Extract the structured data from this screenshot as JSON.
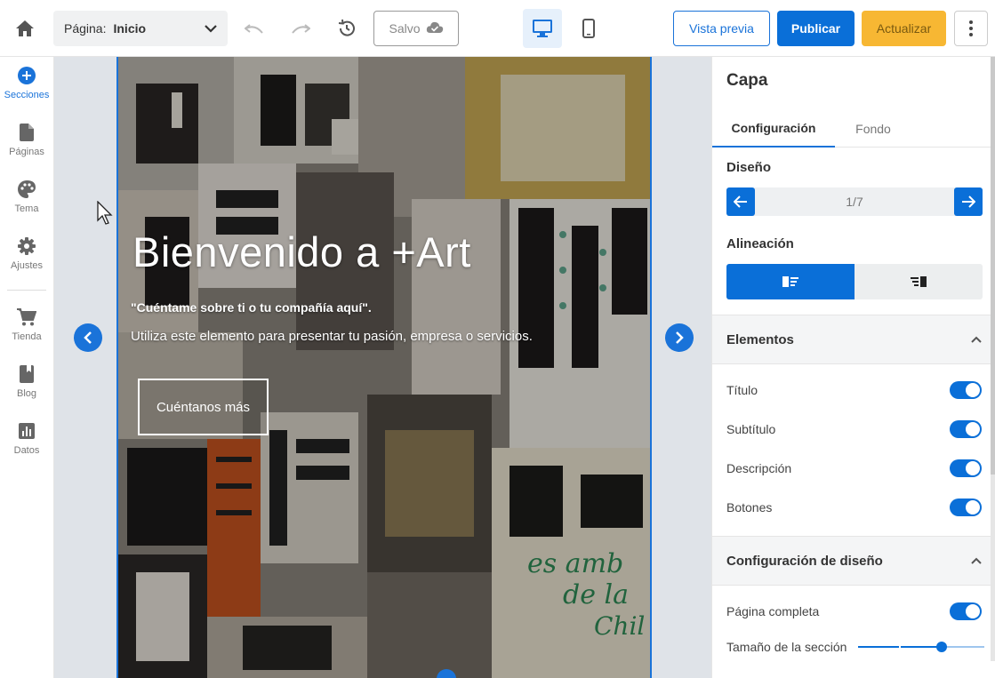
{
  "topbar": {
    "page_label": "Página:",
    "page_value": "Inicio",
    "saved_label": "Salvo",
    "preview_label": "Vista previa",
    "publish_label": "Publicar",
    "update_label": "Actualizar"
  },
  "leftnav": {
    "items": [
      {
        "label": "Secciones",
        "icon": "plus-circle-icon"
      },
      {
        "label": "Páginas",
        "icon": "page-icon"
      },
      {
        "label": "Tema",
        "icon": "palette-icon"
      },
      {
        "label": "Ajustes",
        "icon": "gear-icon"
      },
      {
        "label": "Tienda",
        "icon": "cart-icon"
      },
      {
        "label": "Blog",
        "icon": "book-icon"
      },
      {
        "label": "Datos",
        "icon": "bar-chart-icon"
      }
    ]
  },
  "hero": {
    "title": "Bienvenido a +Art",
    "subtitle": "\"Cuéntame sobre ti o tu compañía aquí\".",
    "description": "Utiliza este elemento para presentar tu pasión, empresa o servicios.",
    "cta_label": "Cuéntanos más"
  },
  "panel": {
    "title": "Capa",
    "tabs": [
      "Configuración",
      "Fondo"
    ],
    "design_label": "Diseño",
    "design_value": "1/7",
    "alignment_label": "Alineación",
    "elements_header": "Elementos",
    "elements": [
      {
        "label": "Título",
        "on": true
      },
      {
        "label": "Subtítulo",
        "on": true
      },
      {
        "label": "Descripción",
        "on": true
      },
      {
        "label": "Botones",
        "on": true
      }
    ],
    "design_config_header": "Configuración de diseño",
    "full_page_label": "Página completa",
    "section_size_label": "Tamaño de la sección",
    "section_size_value": 0.66
  },
  "colors": {
    "accent": "#0a6fd8",
    "update": "#f7b733",
    "canvas": "#dfe3e8"
  }
}
